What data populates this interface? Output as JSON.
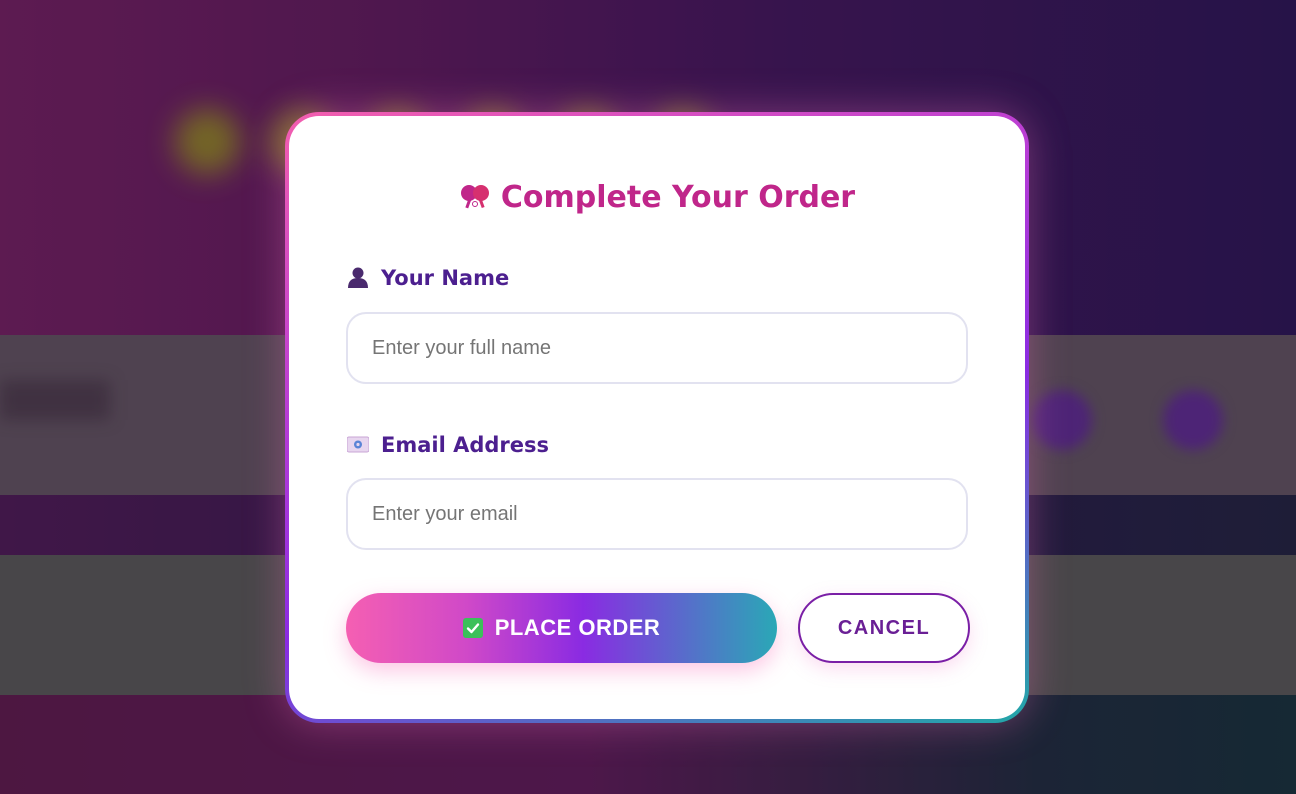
{
  "modal": {
    "title": "Complete Your Order",
    "title_icon": "ping-pong-paddles-icon",
    "name_field": {
      "label": "Your Name",
      "icon": "user-silhouette-icon",
      "placeholder": "Enter your full name",
      "value": ""
    },
    "email_field": {
      "label": "Email Address",
      "icon": "envelope-icon",
      "placeholder": "Enter your email",
      "value": ""
    },
    "buttons": {
      "place_order": "PLACE ORDER",
      "place_order_icon": "check-mark-button-icon",
      "cancel": "CANCEL"
    }
  },
  "colors": {
    "title": "#c0268a",
    "label": "#4c1f8f",
    "gradient_start": "#f55fb2",
    "gradient_mid": "#8a2be2",
    "gradient_end": "#2aa8b6",
    "cancel_border": "#7a1fa6"
  }
}
